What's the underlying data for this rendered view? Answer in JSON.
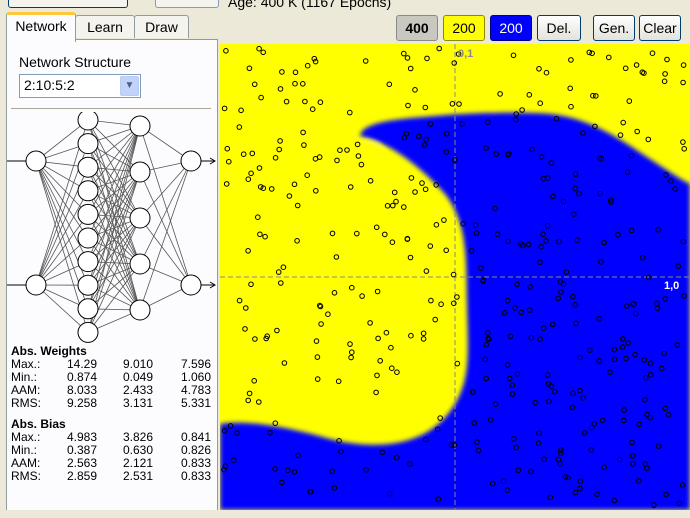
{
  "header": {
    "age_text": "Age:   400 K (1167 Epochs)"
  },
  "tabs": [
    {
      "label": "Network"
    },
    {
      "label": "Learn"
    },
    {
      "label": "Draw"
    }
  ],
  "network_panel": {
    "structure_label": "Network Structure",
    "structure_value": "2:10:5:2",
    "topology": [
      2,
      10,
      5,
      2
    ]
  },
  "weights": {
    "title": "Abs. Weights",
    "rows": [
      {
        "label": "Max.:",
        "v1": "14.29",
        "v2": "9.010",
        "v3": "7.596"
      },
      {
        "label": "Min.:",
        "v1": "0.874",
        "v2": "0.049",
        "v3": "1.060"
      },
      {
        "label": "AAM:",
        "v1": "8.033",
        "v2": "2.433",
        "v3": "4.783"
      },
      {
        "label": "RMS:",
        "v1": "9.258",
        "v2": "3.131",
        "v3": "5.331"
      }
    ]
  },
  "bias": {
    "title": "Abs. Bias",
    "rows": [
      {
        "label": "Max.:",
        "v1": "4.983",
        "v2": "3.826",
        "v3": "0.841"
      },
      {
        "label": "Min.:",
        "v1": "0.387",
        "v2": "0.630",
        "v3": "0.826"
      },
      {
        "label": "AAM:",
        "v1": "2.563",
        "v2": "2.121",
        "v3": "0.833"
      },
      {
        "label": "RMS:",
        "v1": "2.859",
        "v2": "2.531",
        "v3": "0.833"
      }
    ]
  },
  "toolbar": {
    "count_all": "400",
    "count_yellow": "200",
    "count_blue": "200",
    "del_label": "Del.",
    "gen_label": "Gen.",
    "clear_label": "Clear"
  },
  "plot": {
    "label_top": "0,1",
    "label_right": "1,0",
    "colors": {
      "class_a": "#ffff00",
      "class_b": "#0000ff",
      "background": "#ece9d8"
    }
  }
}
